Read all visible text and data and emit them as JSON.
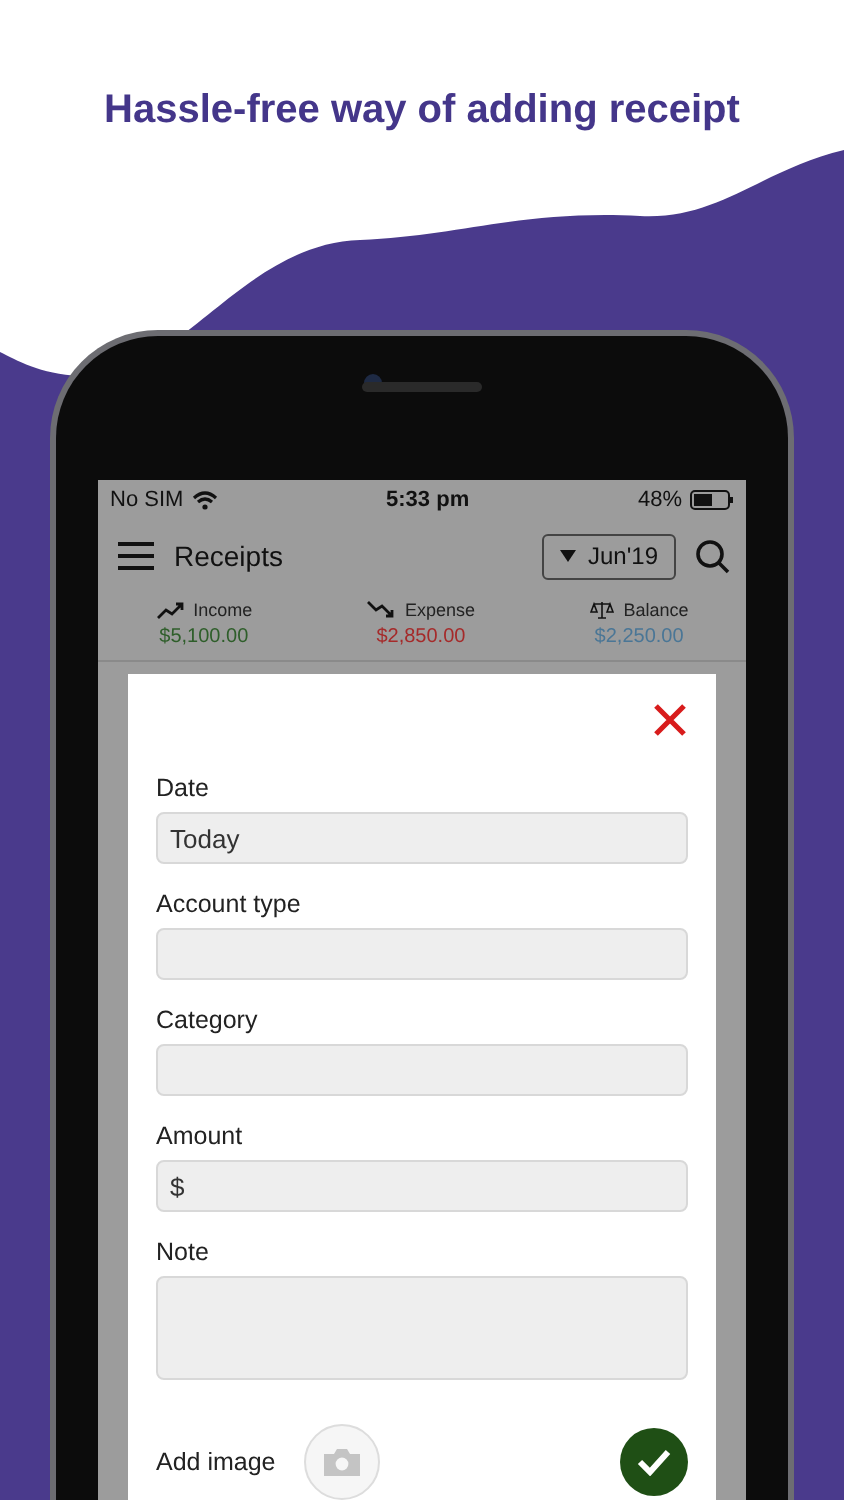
{
  "headline": "Hassle-free way of adding receipt",
  "status_bar": {
    "carrier": "No SIM",
    "time": "5:33 pm",
    "battery": "48%"
  },
  "header": {
    "title": "Receipts",
    "month": "Jun'19"
  },
  "summary": [
    {
      "kind": "income",
      "label": "Income",
      "amount": "$5,100.00",
      "color": "#2e5e2a"
    },
    {
      "kind": "expense",
      "label": "Expense",
      "amount": "$2,850.00",
      "color": "#a52a2a"
    },
    {
      "kind": "balance",
      "label": "Balance",
      "amount": "$2,250.00",
      "color": "#4a7696"
    }
  ],
  "form": {
    "fields": [
      {
        "kind": "single",
        "label": "Date",
        "value": "Today"
      },
      {
        "kind": "single",
        "label": "Account type"
      },
      {
        "kind": "single",
        "label": "Category"
      },
      {
        "kind": "single",
        "label": "Amount",
        "value": "$"
      },
      {
        "kind": "multiline",
        "label": "Note"
      }
    ],
    "add_image_label": "Add image"
  }
}
